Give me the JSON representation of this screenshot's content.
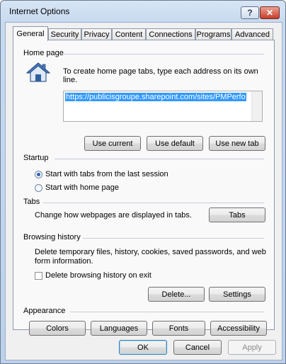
{
  "window": {
    "title": "Internet Options",
    "help_label": "?",
    "close_label": "✕"
  },
  "tabs": [
    {
      "label": "General"
    },
    {
      "label": "Security"
    },
    {
      "label": "Privacy"
    },
    {
      "label": "Content"
    },
    {
      "label": "Connections"
    },
    {
      "label": "Programs"
    },
    {
      "label": "Advanced"
    }
  ],
  "home_page": {
    "group_label": "Home page",
    "icon": "house-icon",
    "description": "To create home page tabs, type each address on its own line.",
    "url": "https://publicisgroupe.sharepoint.com/sites/PMPerfo",
    "buttons": {
      "use_current": "Use current",
      "use_default": "Use default",
      "use_new_tab": "Use new tab"
    }
  },
  "startup": {
    "group_label": "Startup",
    "option_last_session": "Start with tabs from the last session",
    "option_home_page": "Start with home page",
    "selected": "last_session"
  },
  "tabs_group": {
    "group_label": "Tabs",
    "description": "Change how webpages are displayed in tabs.",
    "button": "Tabs"
  },
  "browsing_history": {
    "group_label": "Browsing history",
    "description_line1": "Delete temporary files, history, cookies, saved passwords, and web",
    "description_line2": "form information.",
    "checkbox_label": "Delete browsing history on exit",
    "checked": false,
    "delete_button": "Delete...",
    "settings_button": "Settings"
  },
  "appearance": {
    "group_label": "Appearance",
    "buttons": {
      "colors": "Colors",
      "languages": "Languages",
      "fonts": "Fonts",
      "accessibility": "Accessibility"
    }
  },
  "footer": {
    "ok": "OK",
    "cancel": "Cancel",
    "apply": "Apply"
  },
  "colors": {
    "selection": "#3399ff",
    "close_button": "#c63d2a",
    "title_bar": "#c8daf0"
  }
}
